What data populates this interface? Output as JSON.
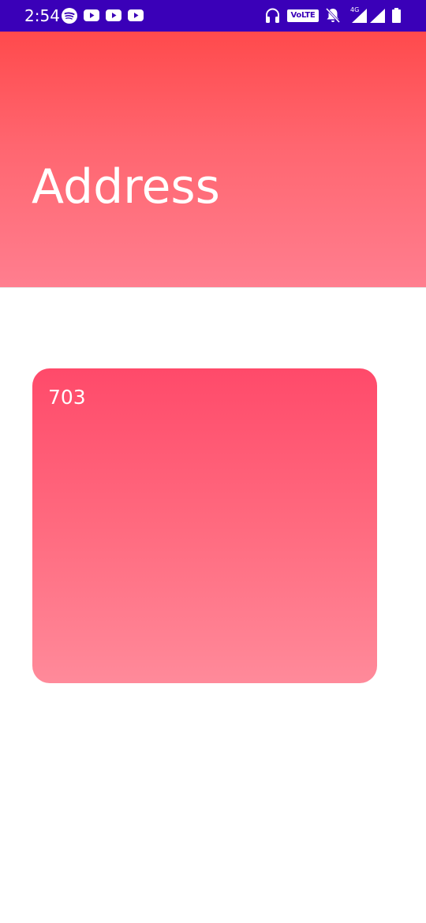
{
  "status_bar": {
    "time": "2:54",
    "volte_label": "VoLTE",
    "network_label": "4G",
    "background_color": "#3a00b8",
    "notification_icons": [
      "spotify-icon",
      "youtube-icon",
      "youtube-icon",
      "youtube-icon"
    ],
    "system_icons": [
      "headset-icon",
      "volte-badge",
      "mute-icon",
      "signal-icon",
      "signal-icon",
      "battery-icon"
    ]
  },
  "header": {
    "title": "Address",
    "gradient_colors": [
      "#ff4a4c",
      "#ff7e8f"
    ]
  },
  "card": {
    "text": "703",
    "gradient_colors": [
      "#ff4a6a",
      "#ff8a9a"
    ]
  }
}
